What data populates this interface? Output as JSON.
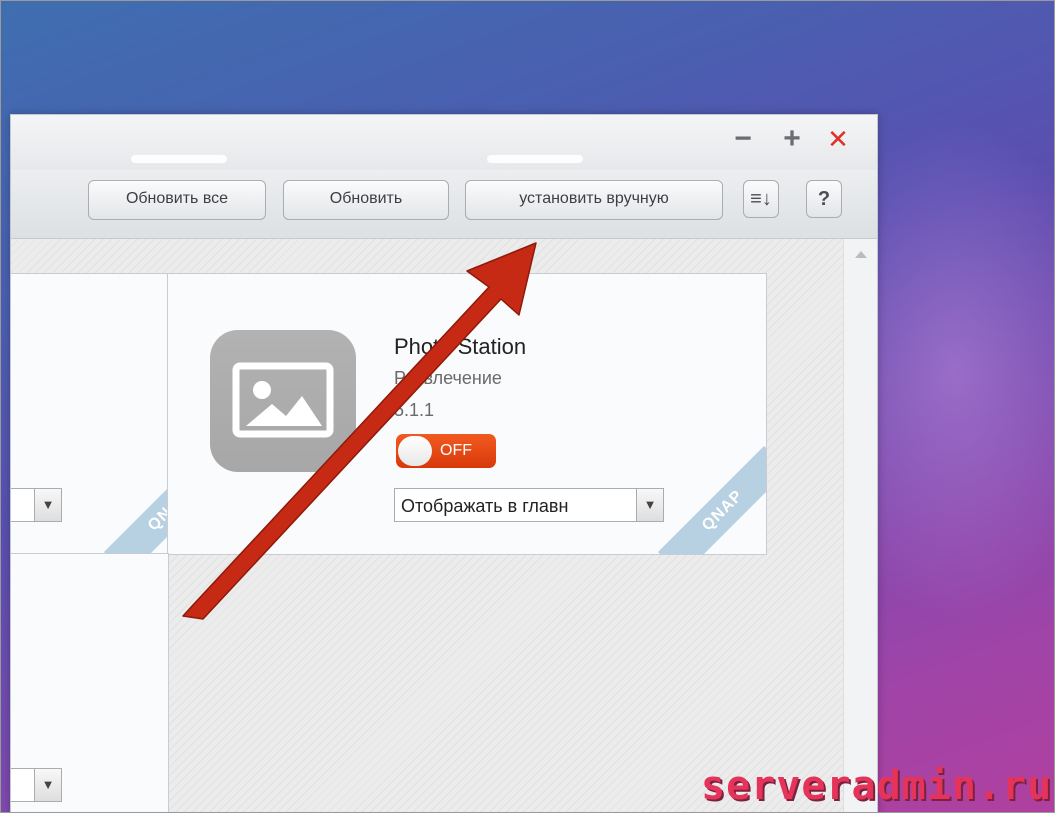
{
  "window": {
    "controls": {
      "minimize": "−",
      "maximize": "+",
      "close": "✕"
    }
  },
  "toolbar": {
    "update_all_label": "Обновить все",
    "update_label": "Обновить",
    "install_manual_label": "установить вручную",
    "sort_icon_glyph": "≡↓",
    "help_label": "?"
  },
  "cards": {
    "left_top": {
      "select_value": "ł",
      "ribbon": "QNAP"
    },
    "photo_station": {
      "name": "Photo Station",
      "category": "Развлечение",
      "version": "5.1.1",
      "toggle_label": "OFF",
      "select_value": "Отображать в главн",
      "ribbon": "QNAP"
    },
    "left_bottom": {
      "select_value": "ɔ"
    }
  },
  "watermark": "serveradmin.ru",
  "colors": {
    "annotation_arrow": "#c62a14",
    "toggle_off": "#e3460f",
    "close_icon": "#e0302a",
    "ribbon": "#b7d0e2"
  }
}
